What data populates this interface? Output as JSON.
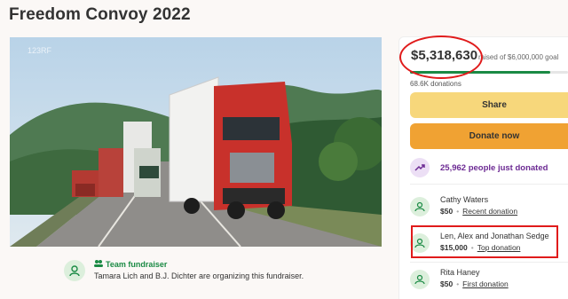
{
  "page": {
    "title": "Freedom Convoy 2022"
  },
  "photo": {
    "watermark": "123RF"
  },
  "organizer": {
    "badge": "Team fundraiser",
    "text": "Tamara Lich and B.J. Dichter are organizing this fundraiser."
  },
  "funding": {
    "amount": "$5,318,630",
    "goal_text": "raised of $6,000,000 goal",
    "progress_fraction": 0.886,
    "donations": "68.6K donations"
  },
  "buttons": {
    "share": "Share",
    "donate": "Donate now"
  },
  "trend": {
    "text": "25,962 people just donated"
  },
  "donors": [
    {
      "name": "Cathy Waters",
      "amount": "$50",
      "tag": "Recent donation"
    },
    {
      "name": "Len, Alex and Jonathan Sedge",
      "amount": "$15,000",
      "tag": "Top donation"
    },
    {
      "name": "Rita Haney",
      "amount": "$50",
      "tag": "First donation"
    }
  ],
  "colors": {
    "accent": "#1a8a44",
    "share": "#f7d77b",
    "donate": "#f0a233",
    "highlight": "#e01b1b",
    "trend": "#6c2a93"
  },
  "icons": {
    "donor": "hand-heart-icon",
    "trend": "trending-up-icon",
    "team": "team-icon"
  }
}
